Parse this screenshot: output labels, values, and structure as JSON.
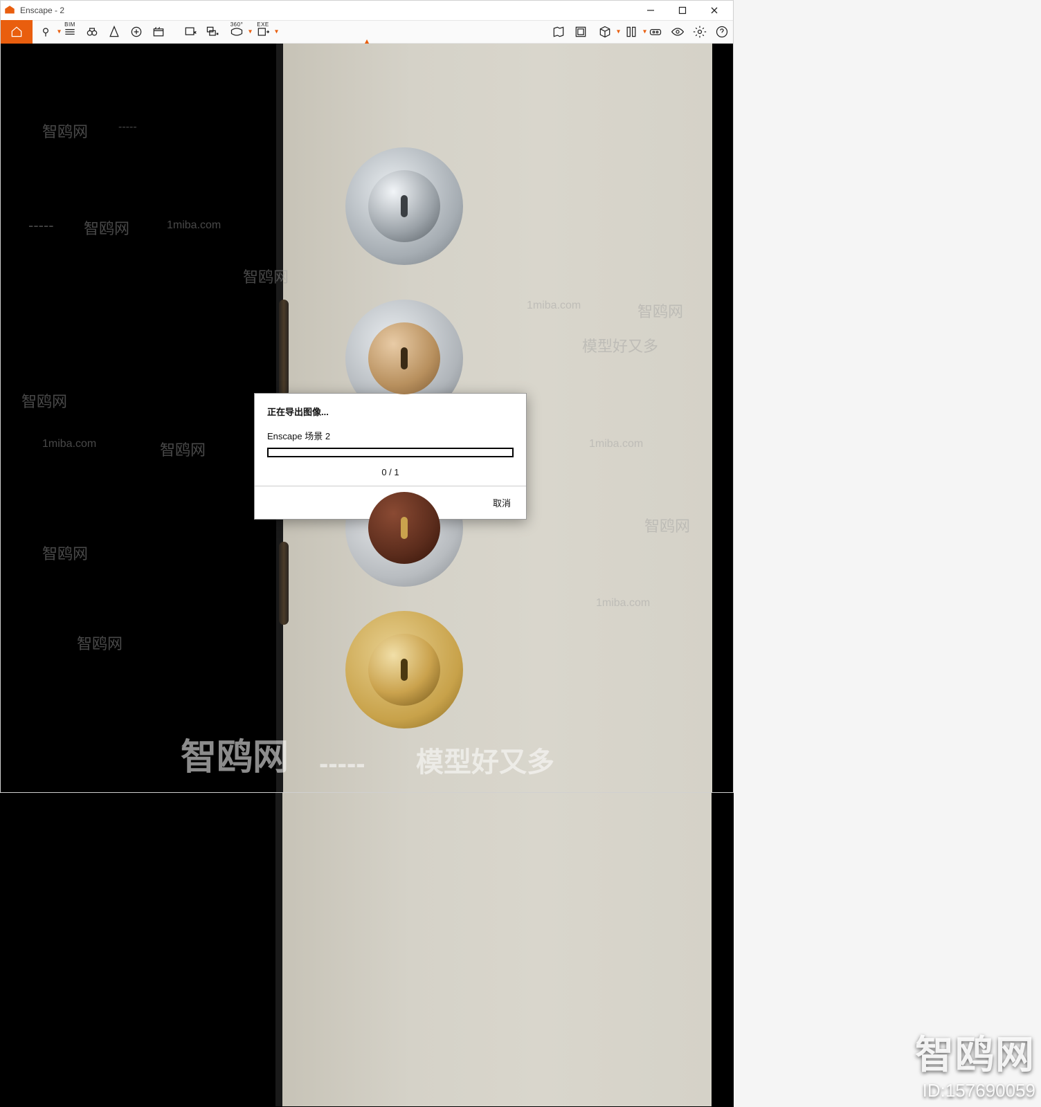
{
  "window": {
    "title": "Enscape - 2",
    "controls": {
      "minimize": "—",
      "maximize": "▢",
      "close": "✕"
    }
  },
  "toolbar": {
    "left": [
      {
        "name": "home-icon"
      },
      {
        "name": "pin-icon",
        "dropdown": true
      },
      {
        "name": "bim-icon",
        "label": "BIM"
      },
      {
        "name": "binoculars-icon"
      },
      {
        "name": "compass-icon"
      },
      {
        "name": "plus-icon"
      },
      {
        "name": "clapper-icon"
      },
      {
        "name": "image-export-icon"
      },
      {
        "name": "batch-export-icon"
      },
      {
        "name": "pano-icon",
        "label": "360°"
      },
      {
        "name": "exe-export-icon",
        "label": "EXE",
        "dropdown": true
      }
    ],
    "right": [
      {
        "name": "map-icon"
      },
      {
        "name": "assets-icon"
      },
      {
        "name": "cube-icon",
        "dropdown": true
      },
      {
        "name": "book-icon",
        "dropdown": true
      },
      {
        "name": "vr-icon"
      },
      {
        "name": "eye-icon"
      },
      {
        "name": "settings-icon"
      },
      {
        "name": "help-icon"
      }
    ]
  },
  "dialog": {
    "title": "正在导出图像...",
    "scene": "Enscape 场景 2",
    "progress_text": "0 / 1",
    "cancel": "取消"
  },
  "watermarks": {
    "zh": "智鸥网",
    "domain": "1miba.com",
    "tagline": "模型好又多",
    "dashes": "-----"
  },
  "corner": {
    "brand": "智鸥网",
    "id_label": "ID:157690059"
  }
}
